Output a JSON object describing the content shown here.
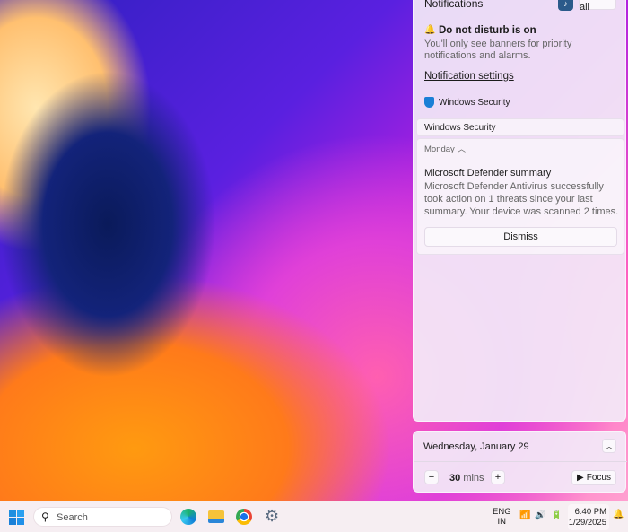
{
  "notifications": {
    "title": "Notifications",
    "clear_all": "Clear all",
    "dnd_title": "Do not disturb is on",
    "dnd_body": "You'll only see banners for priority notifications and alarms.",
    "settings_link": "Notification settings",
    "app_name": "Windows Security",
    "group_header": "Windows Security",
    "day": "Monday",
    "card_title": "Microsoft Defender summary",
    "card_body": "Microsoft Defender Antivirus successfully took action on 1 threats since your last summary. Your device was scanned 2 times.",
    "dismiss": "Dismiss"
  },
  "calendar": {
    "date": "Wednesday, January 29",
    "focus_value": "30",
    "focus_unit": "mins",
    "focus_label": "Focus"
  },
  "taskbar": {
    "search_placeholder": "Search",
    "lang_1": "ENG",
    "lang_2": "IN",
    "time": "6:40 PM",
    "date": "1/29/2025"
  },
  "colors": {
    "accent": "#2b5a8a",
    "shield": "#1a7fd6"
  }
}
